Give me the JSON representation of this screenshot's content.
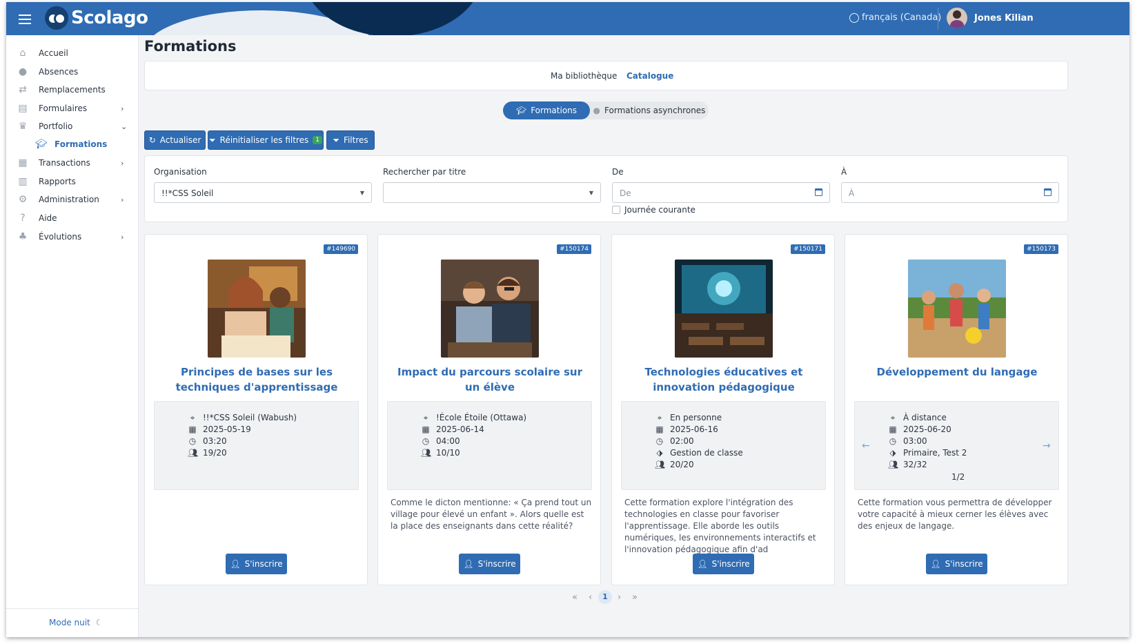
{
  "header": {
    "brand": "Scolago",
    "language": "français (Canada)",
    "user_name": "Jones Kilian"
  },
  "sidebar": {
    "items": [
      {
        "label": "Accueil",
        "icon": "home-icon"
      },
      {
        "label": "Absences",
        "icon": "user-clock-icon"
      },
      {
        "label": "Remplacements",
        "icon": "swap-icon"
      },
      {
        "label": "Formulaires",
        "icon": "file-icon"
      },
      {
        "label": "Portfolio",
        "icon": "trophy-icon"
      },
      {
        "label": "Formations",
        "icon": "graduation-cap-icon"
      },
      {
        "label": "Transactions",
        "icon": "table-icon"
      },
      {
        "label": "Rapports",
        "icon": "report-icon"
      },
      {
        "label": "Administration",
        "icon": "gear-icon"
      },
      {
        "label": "Aide",
        "icon": "question-icon"
      },
      {
        "label": "Évolutions",
        "icon": "seedling-icon"
      }
    ],
    "night_mode": "Mode nuit"
  },
  "page": {
    "title": "Formations",
    "tabs": [
      "Ma bibliothèque",
      "Catalogue"
    ],
    "segments": [
      "Formations",
      "Formations asynchrones"
    ]
  },
  "toolbar": {
    "refresh": "Actualiser",
    "reset_filters": "Réinitialiser les filtres",
    "reset_badge": "1",
    "filters": "Filtres"
  },
  "filters": {
    "org_label": "Organisation",
    "org_value": "!!*CSS Soleil",
    "search_label": "Rechercher par titre",
    "from_label": "De",
    "from_placeholder": "De",
    "to_label": "À",
    "to_placeholder": "À",
    "today_label": "Journée courante"
  },
  "cards": [
    {
      "id": "#149690",
      "title": "Principes de bases sur les techniques d'apprentissage",
      "location": "!!*CSS Soleil (Wabush)",
      "date": "2025-05-19",
      "duration": "03:20",
      "seats": "19/20",
      "description": "",
      "button": "S'inscrire"
    },
    {
      "id": "#150174",
      "title": "Impact du parcours scolaire sur un élève",
      "location": "!École Étoile (Ottawa)",
      "date": "2025-06-14",
      "duration": "04:00",
      "seats": "10/10",
      "description": "Comme le dicton mentionne: « Ça prend tout un village pour élevé un enfant ». Alors quelle est la place des enseignants dans cette réalité?",
      "button": "S'inscrire"
    },
    {
      "id": "#150171",
      "title": "Technologies éducatives et innovation pédagogique",
      "location": "En personne",
      "date": "2025-06-16",
      "duration": "02:00",
      "tags": "Gestion de classe",
      "seats": "20/20",
      "description": "Cette formation explore l'intégration des technologies en classe pour favoriser l'apprentissage. Elle aborde les outils numériques, les environnements interactifs et l'innovation pédagogique afin d'ad",
      "button": "S'inscrire"
    },
    {
      "id": "#150173",
      "title": "Développement du langage",
      "location": "À distance",
      "date": "2025-06-20",
      "duration": "03:00",
      "tags": "Primaire, Test 2",
      "seats": "32/32",
      "pager": "1/2",
      "description": "Cette formation vous permettra de développer votre capacité à mieux cerner les élèves avec des enjeux de langage.",
      "button": "S'inscrire"
    }
  ],
  "pagination": {
    "current": "1"
  },
  "colors": {
    "primary": "#2f6cb3",
    "badge_green": "#3aa35b"
  }
}
